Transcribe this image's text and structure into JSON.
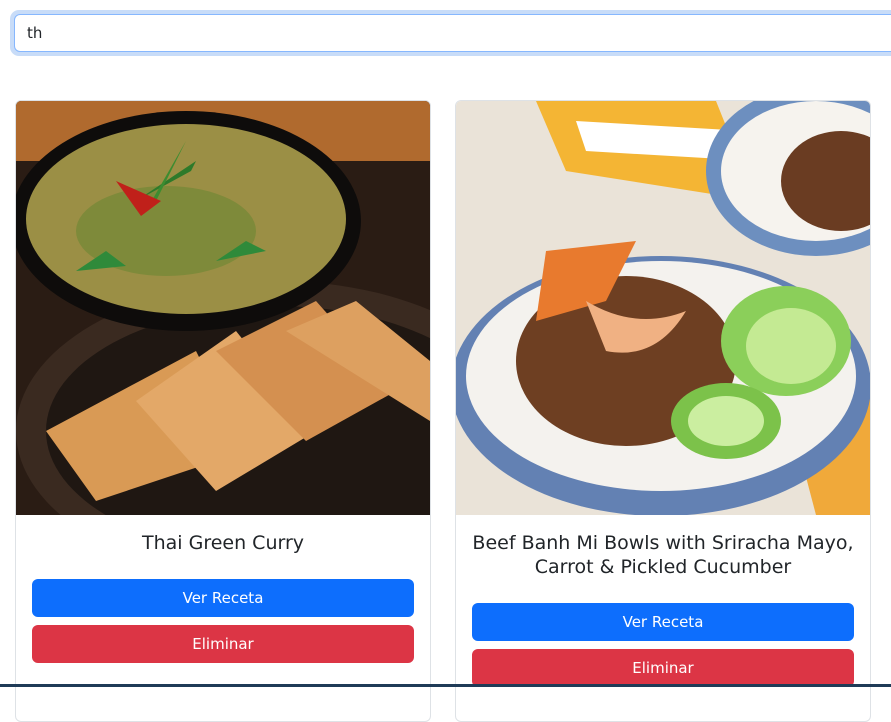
{
  "search": {
    "value": "th"
  },
  "recipes": [
    {
      "title": "Thai Green Curry",
      "view_label": "Ver Receta",
      "delete_label": "Eliminar",
      "image_alt": "Thai Green Curry"
    },
    {
      "title": "Beef Banh Mi Bowls with Sriracha Mayo, Carrot & Pickled Cucumber",
      "view_label": "Ver Receta",
      "delete_label": "Eliminar",
      "image_alt": "Beef Banh Mi Bowls with Sriracha Mayo, Carrot & Pickled Cucumber"
    }
  ],
  "colors": {
    "primary": "#0d6efd",
    "danger": "#dc3545",
    "focus_ring": "#86b7fe"
  }
}
